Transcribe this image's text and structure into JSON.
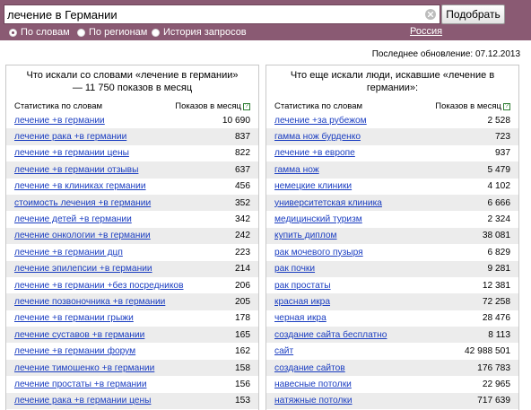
{
  "search": {
    "value": "лечение в Германии",
    "button_label": "Подобрать"
  },
  "modes": [
    {
      "label": "По словам",
      "selected": true
    },
    {
      "label": "По регионам",
      "selected": false
    },
    {
      "label": "История запросов",
      "selected": false
    }
  ],
  "region_link": "Россия",
  "last_update": "Последнее обновление: 07.12.2013",
  "left_panel": {
    "title": "Что искали со словами «лечение в германии» — 11 750 показов в месяц",
    "col_words": "Статистика по словам",
    "col_shows": "Показов в месяц",
    "rows": [
      {
        "kw": "лечение +в германии",
        "count": "10 690"
      },
      {
        "kw": "лечение рака +в германии",
        "count": "837"
      },
      {
        "kw": "лечение +в германии цены",
        "count": "822"
      },
      {
        "kw": "лечение +в германии отзывы",
        "count": "637"
      },
      {
        "kw": "лечение +в клиниках германии",
        "count": "456"
      },
      {
        "kw": "стоимость лечения +в германии",
        "count": "352"
      },
      {
        "kw": "лечение детей +в германии",
        "count": "342"
      },
      {
        "kw": "лечение онкологии +в германии",
        "count": "242"
      },
      {
        "kw": "лечение +в германии дцп",
        "count": "223"
      },
      {
        "kw": "лечение эпилепсии +в германии",
        "count": "214"
      },
      {
        "kw": "лечение +в германии +без посредников",
        "count": "206"
      },
      {
        "kw": "лечение позвоночника +в германии",
        "count": "205"
      },
      {
        "kw": "лечение +в германии грыжи",
        "count": "178"
      },
      {
        "kw": "лечение суставов +в германии",
        "count": "165"
      },
      {
        "kw": "лечение +в германии форум",
        "count": "162"
      },
      {
        "kw": "лечение тимошенко +в германии",
        "count": "158"
      },
      {
        "kw": "лечение простаты +в германии",
        "count": "156"
      },
      {
        "kw": "лечение рака +в германии цены",
        "count": "153"
      }
    ]
  },
  "right_panel": {
    "title": "Что еще искали люди, искавшие «лечение в германии»:",
    "col_words": "Статистика по словам",
    "col_shows": "Показов в месяц",
    "rows": [
      {
        "kw": "лечение +за рубежом",
        "count": "2 528"
      },
      {
        "kw": "гамма нож бурденко",
        "count": "723"
      },
      {
        "kw": "лечение +в европе",
        "count": "937"
      },
      {
        "kw": "гамма нож",
        "count": "5 479"
      },
      {
        "kw": "немецкие клиники",
        "count": "4 102"
      },
      {
        "kw": "университетская клиника",
        "count": "6 666"
      },
      {
        "kw": "медицинский туризм",
        "count": "2 324"
      },
      {
        "kw": "купить диплом",
        "count": "38 081"
      },
      {
        "kw": "рак мочевого пузыря",
        "count": "6 829"
      },
      {
        "kw": "рак почки",
        "count": "9 281"
      },
      {
        "kw": "рак простаты",
        "count": "12 381"
      },
      {
        "kw": "красная икра",
        "count": "72 258"
      },
      {
        "kw": "черная икра",
        "count": "28 476"
      },
      {
        "kw": "создание сайта бесплатно",
        "count": "8 113"
      },
      {
        "kw": "сайт",
        "count": "42 988 501"
      },
      {
        "kw": "создание сайтов",
        "count": "176 783"
      },
      {
        "kw": "навесные потолки",
        "count": "22 965"
      },
      {
        "kw": "натяжные потолки",
        "count": "717 639"
      }
    ]
  },
  "colors": {
    "topbar": "#8a5a73",
    "link": "#1a3dc1",
    "row_alt": "#ececec"
  }
}
